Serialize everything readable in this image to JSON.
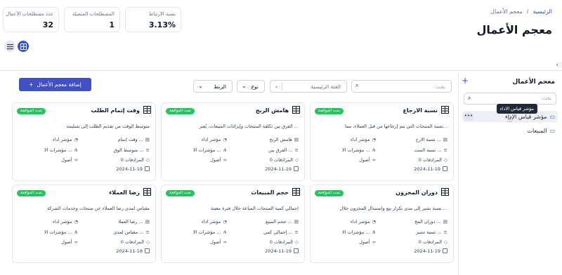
{
  "breadcrumb": {
    "home": "الرئيسية",
    "separator": "/",
    "current": "معجم الأعمال"
  },
  "page_title": "معجم الأعمال",
  "stats": [
    {
      "label": "عدد مصطلحات الأعمال",
      "value": "32"
    },
    {
      "label": "المصطلحات المتصلة",
      "value": "1"
    },
    {
      "label": "نسبة الارتباط",
      "value": "3.13%"
    }
  ],
  "sidebar": {
    "title": "معجم الأعمال",
    "search_placeholder": "بحث",
    "items": [
      {
        "label": "مؤشر قياس الإداء"
      },
      {
        "label": "المبيعات"
      }
    ],
    "tooltip": "مؤشر قياس الاداء"
  },
  "toolbar": {
    "add_button": "إضافة معجم الأعمال",
    "search_placeholder": "بحث",
    "category_placeholder": "الفئة الرئيسية",
    "type_label": "نوع",
    "link_label": "الربط"
  },
  "cards": [
    {
      "title": "نسبة الارجاع",
      "badge": "تمت الموافقة",
      "desc": "نسبة المنتجات التي يتم إرجاعها من قبل العملاء، مما...",
      "name_short": "نسبة الارج ...",
      "type": "مؤشر اداء",
      "abbr": "نسبة المنت ...",
      "link": "مؤشرات الا ...",
      "synonyms": "0 المرادفات",
      "origin": "أصول",
      "date": "2024-11-19"
    },
    {
      "title": "هامش الربح",
      "badge": "تمت الموافقة",
      "desc": "الفرق بين تكلفة المنتجات وإيرادات المبيعات، يُعبر ...",
      "name_short": "هامش الربح",
      "type": "مؤشر اداء",
      "abbr": "الفرق بين ...",
      "link": "مؤشرات الا ...",
      "synonyms": "0 المرادفات",
      "origin": "أصول",
      "date": "2024-11-19"
    },
    {
      "title": "وقت إتمام الطلب",
      "badge": "تمت الموافقة",
      "desc": "متوسط الوقت من تقديم الطلب إلى تسليمه",
      "name_short": "وقت إتمام ...",
      "type": "مؤشر اداء",
      "abbr": "متوسط الوق ...",
      "link": "مؤشرات الا ...",
      "synonyms": "0 المرادفات",
      "origin": "أصول",
      "date": "2024-11-19"
    },
    {
      "title": "دوران المخزون",
      "badge": "تمت الموافقة",
      "desc": "نسبة تشير إلى مدى تكرار بيع واستبدال المخزون خلال ...",
      "name_short": "دوران المخ ...",
      "type": "مؤشر اداء",
      "abbr": "نسبة تشير ...",
      "link": "مؤشرات الا ...",
      "synonyms": "0 المرادفات",
      "origin": "أصول",
      "date": "2024-11-19"
    },
    {
      "title": "حجم المبيعات",
      "badge": "تمت الموافقة",
      "desc": "إجمالي كمية المنتجات المباعة خلال فترة معينة",
      "name_short": "حجم المبيع ...",
      "type": "مؤشر اداء",
      "abbr": "إجمالي كمي ...",
      "link": "مؤشرات الا ...",
      "synonyms": "0 المرادفات",
      "origin": "أصول",
      "date": "2024-11-19"
    },
    {
      "title": "رضا العملاء",
      "badge": "تمت الموافقة",
      "desc": "مقياس لمدى رضا العملاء عن منتجات وخدمات الشركة",
      "name_short": "رضا العملا ...",
      "type": "مؤشر اداء",
      "abbr": "مقياس لمدى ...",
      "link": "مؤشرات الا ...",
      "synonyms": "0 المرادفات",
      "origin": "أصول",
      "date": "2024-11-18"
    }
  ]
}
